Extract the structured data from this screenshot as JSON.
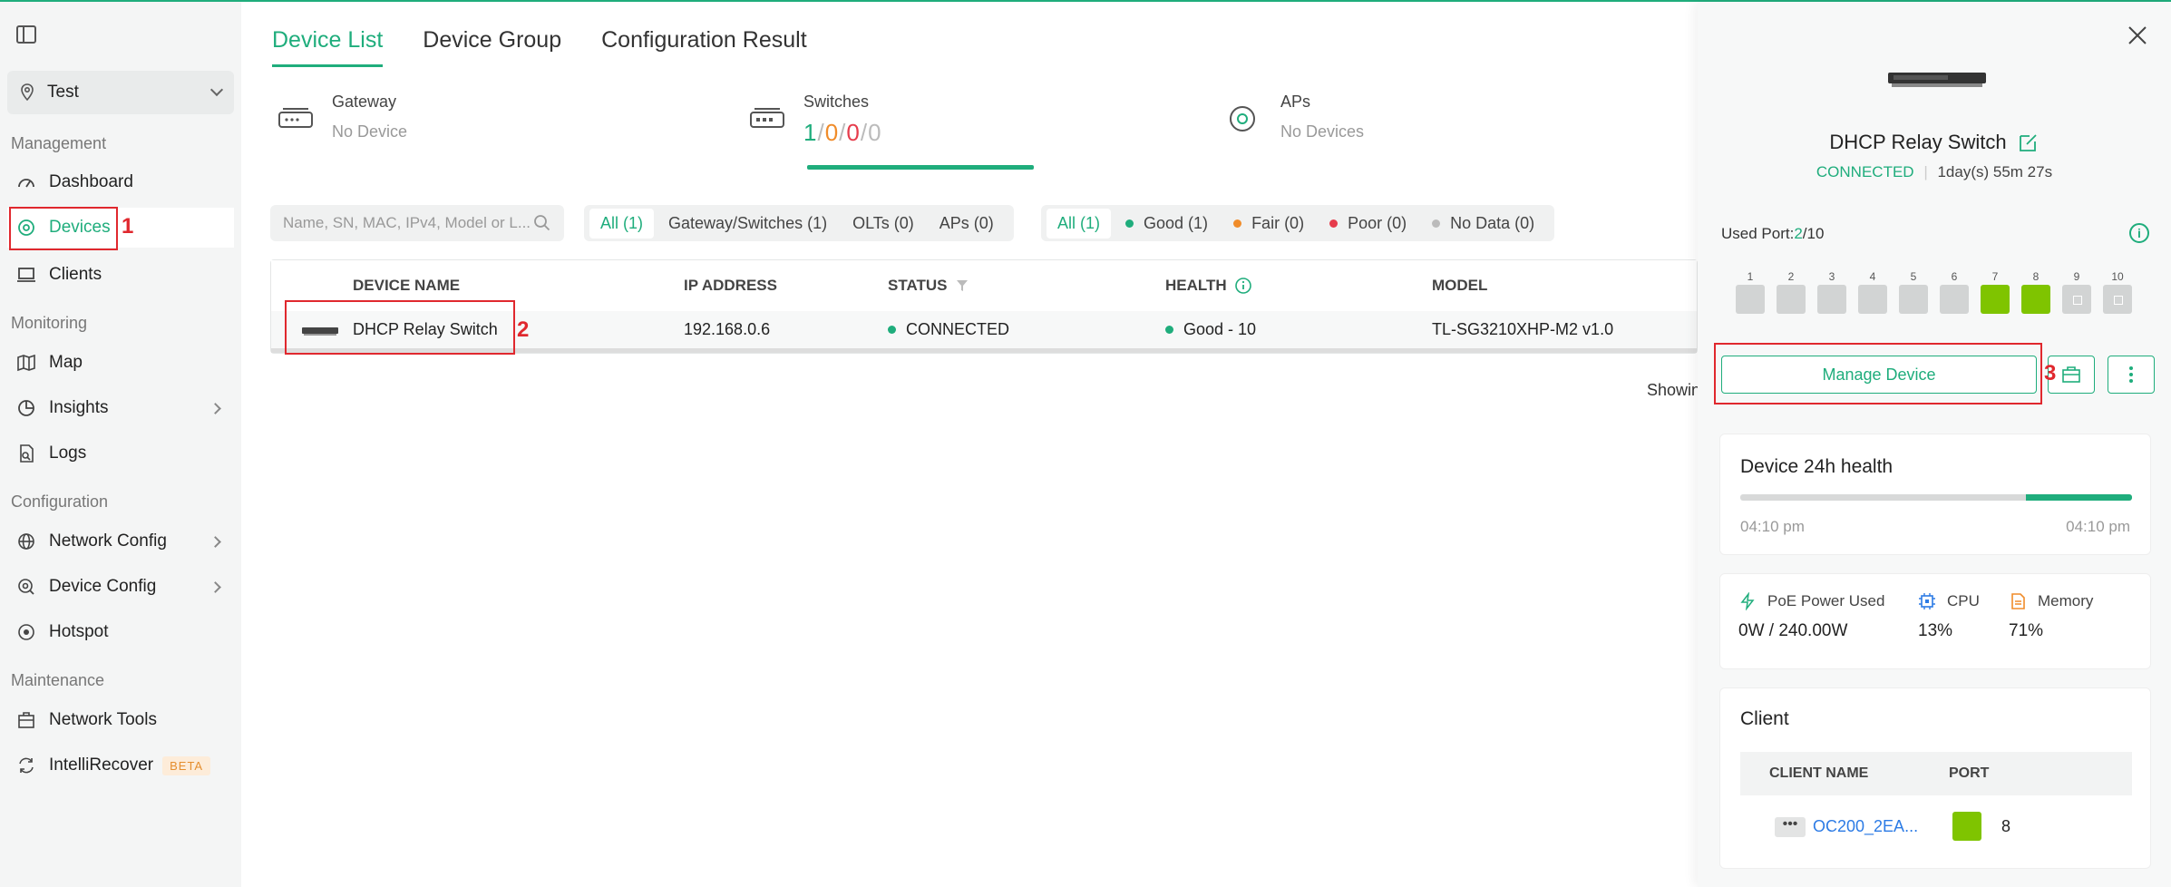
{
  "sidebar": {
    "site": "Test",
    "sections": {
      "management": "Management",
      "monitoring": "Monitoring",
      "configuration": "Configuration",
      "maintenance": "Maintenance"
    },
    "items": {
      "dashboard": "Dashboard",
      "devices": "Devices",
      "clients": "Clients",
      "map": "Map",
      "insights": "Insights",
      "logs": "Logs",
      "network_config": "Network Config",
      "device_config": "Device Config",
      "hotspot": "Hotspot",
      "network_tools": "Network Tools",
      "intellirecover": "IntelliRecover",
      "beta": "BETA"
    }
  },
  "annotations": {
    "a1": "1",
    "a2": "2",
    "a3": "3"
  },
  "tabs": [
    "Device List",
    "Device Group",
    "Configuration Result"
  ],
  "summary": {
    "gateway": {
      "title": "Gateway",
      "sub": "No Device"
    },
    "switches": {
      "title": "Switches",
      "c1": "1",
      "c2": "0",
      "c3": "0",
      "c4": "0",
      "sep": "/"
    },
    "aps": {
      "title": "APs",
      "sub": "No Devices"
    }
  },
  "search": {
    "placeholder": "Name, SN, MAC, IPv4, Model or L..."
  },
  "type_filters": [
    "All (1)",
    "Gateway/Switches (1)",
    "OLTs (0)",
    "APs (0)"
  ],
  "health_filters": [
    "All (1)",
    "Good (1)",
    "Fair (0)",
    "Poor (0)",
    "No Data (0)"
  ],
  "table": {
    "headers": {
      "device_name": "DEVICE NAME",
      "ip": "IP ADDRESS",
      "status": "STATUS",
      "health": "HEALTH",
      "model": "MODEL"
    },
    "row": {
      "name": "DHCP Relay Switch",
      "ip": "192.168.0.6",
      "status": "CONNECTED",
      "health": "Good - 10",
      "model": "TL-SG3210XHP-M2 v1.0"
    }
  },
  "showing": "Showin",
  "panel": {
    "device_name": "DHCP Relay Switch",
    "status": "CONNECTED",
    "uptime": "1day(s) 55m 27s",
    "used_port_label": "Used Port:",
    "used_port_used": "2",
    "used_port_total": "/10",
    "ports": [
      "1",
      "2",
      "3",
      "4",
      "5",
      "6",
      "7",
      "8",
      "9",
      "10"
    ],
    "manage_label": "Manage Device",
    "health_title": "Device 24h health",
    "health_fraction": 0.27,
    "time_start": "04:10 pm",
    "time_end": "04:10 pm",
    "poe_label": "PoE Power Used",
    "poe_value": "0W / 240.00W",
    "cpu_label": "CPU",
    "cpu_value": "13%",
    "mem_label": "Memory",
    "mem_value": "71%",
    "client_title": "Client",
    "client_headers": {
      "name": "CLIENT NAME",
      "port": "PORT"
    },
    "client": {
      "name": "OC200_2EA...",
      "port": "8"
    }
  },
  "colors": {
    "accent": "#1fad7c",
    "port_up": "#7fc400",
    "fair": "#f08c2a",
    "poor": "#e63c4c",
    "nodata": "#bbbbbb",
    "annotation": "#e0282e"
  }
}
